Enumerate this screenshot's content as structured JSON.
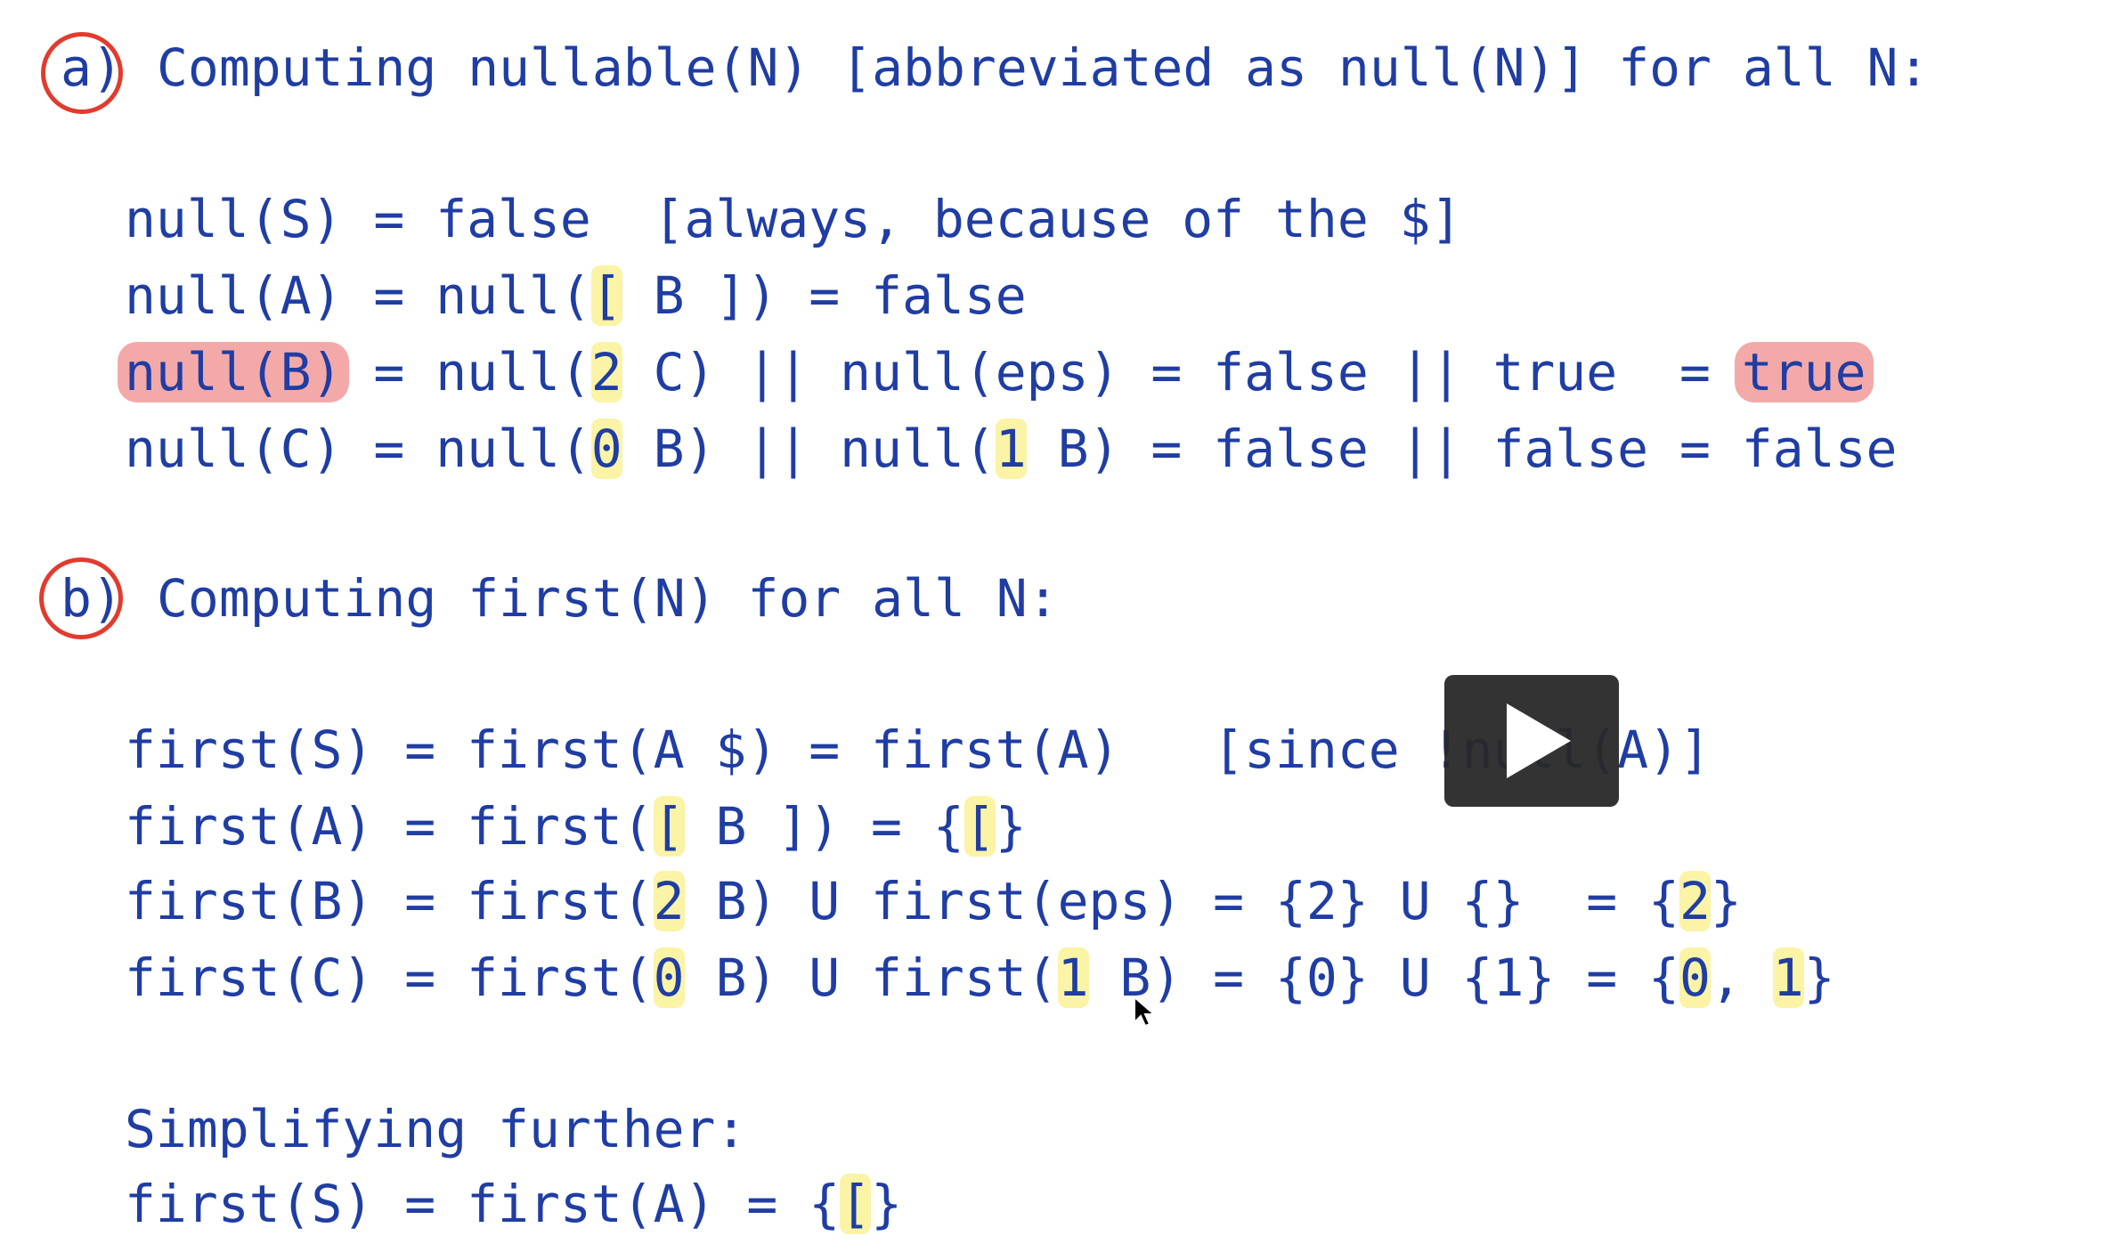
{
  "section_a": {
    "marker": "a)",
    "heading": "Computing nullable(N) [abbreviated as null(N)] for all N:",
    "lines": {
      "s": "null(S) = false  [always, because of the $]",
      "a_1": "null(A) = null(",
      "a_hl1": "[",
      "a_2": " B ]) = false",
      "b_hr1": "null(B)",
      "b_1": " = null(",
      "b_hl1": "2",
      "b_2": " C) || null(eps) = false || true  = ",
      "b_hr2": "true",
      "c_1": "null(C) = null(",
      "c_hl1": "0",
      "c_2": " B) || null(",
      "c_hl2": "1",
      "c_3": " B) = false || false = false"
    }
  },
  "section_b": {
    "marker": "b)",
    "heading": "Computing first(N) for all N:",
    "lines": {
      "s": "first(S) = first(A $) = first(A)   [since !null(A)]",
      "a_1": "first(A) = first(",
      "a_hl1": "[",
      "a_2": " B ]) = {",
      "a_hl2": "[",
      "a_3": "}",
      "b_1": "first(B) = first(",
      "b_hl1": "2",
      "b_2": " B) U first(eps) = {2} U {}  = {",
      "b_hl2": "2",
      "b_3": "}",
      "c_1": "first(C) = first(",
      "c_hl1": "0",
      "c_2": " B) U first(",
      "c_hl2": "1",
      "c_3": " B) = {0} U {1} = {",
      "c_hl3": "0",
      "c_4": ", ",
      "c_hl4": "1",
      "c_5": "}"
    },
    "simplify_label": "Simplifying further:",
    "simplify_1": "first(S) = first(A) = {",
    "simplify_hl": "[",
    "simplify_2": "}"
  },
  "colors": {
    "text": "#1f3da3",
    "highlight_yellow": "#fbf3a6",
    "highlight_red": "#f4a9a9",
    "annotation_circle": "#e23b2e",
    "play_button": "#282828"
  },
  "icons": {
    "play": "play-icon",
    "cursor": "mouse-cursor-icon"
  }
}
